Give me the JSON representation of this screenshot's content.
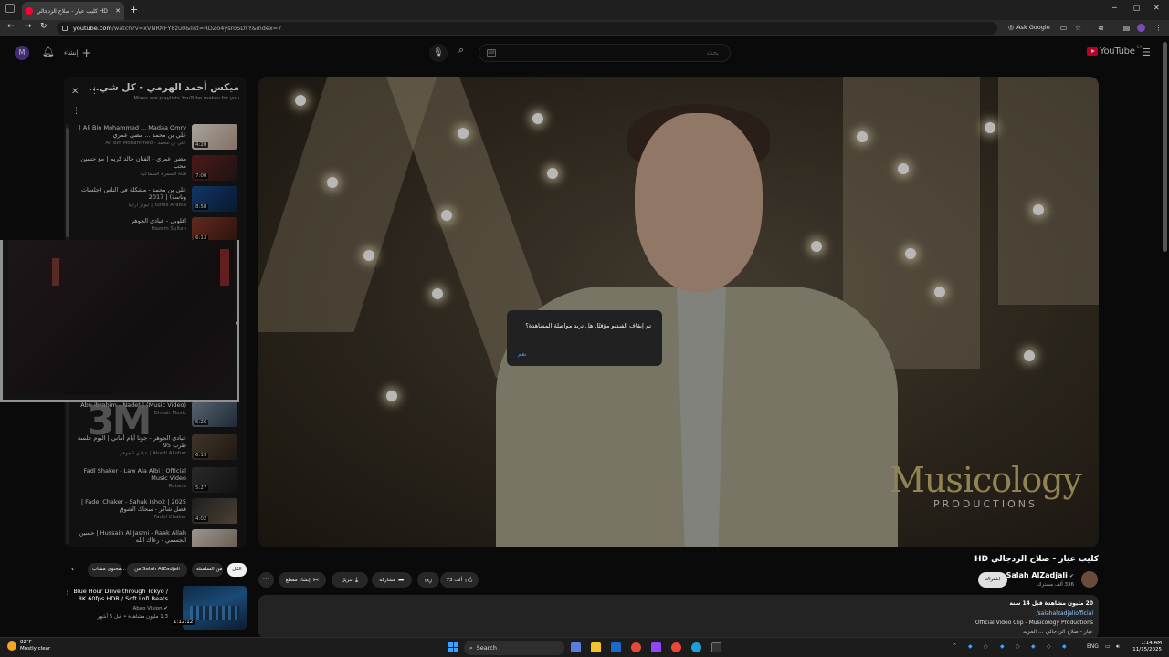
{
  "browser": {
    "tab_title": "كليب عيار - صلاح الزدجالي HD",
    "url_host": "youtube.com",
    "url_path": "/watch?v=xVNRNFY8zu0&list=RDZo4ysroSDYY&index=7",
    "ask_google": "Ask Google"
  },
  "header": {
    "avatar_letter": "M",
    "create_label": "إنشاء",
    "search_placeholder": "بحث",
    "logo_word": "YouTube",
    "logo_region": "SA"
  },
  "playlist": {
    "title": "ميكس أحمد الهرمي - كل شي...",
    "subtitle": "Mixes are playlists YouTube makes for you",
    "items": [
      {
        "title": "Ali Bin Mohammed ... Madaa Omry | علي بن محمد ... مضى عمري",
        "channel": "علي بن محمد - Ali Bin Mohammed",
        "duration": "4:20"
      },
      {
        "title": "مضى عمري - الفنان خالد كريم | مع حسين محب",
        "channel": "قناة السمرة السماعية",
        "duration": "7:00"
      },
      {
        "title": "علي بن محمد - مشكلة في الناس (جلسات وناسة) | 2017",
        "channel": "Tunes Arabia | تيونز أرابيا",
        "duration": "8:58"
      },
      {
        "title": "اقلوبي - عبادي الجوهر",
        "channel": "Hazem Sultan",
        "duration": "6:13"
      },
      {
        "title": "Abu ibrahim - Nadet | (Music Video)",
        "channel": "Dimah Music",
        "duration": "5:26"
      },
      {
        "title": "عبادي الجوهر - جونا أيام أماني | البوم جلسة طرب 95",
        "channel": "Abadi Aljohar | عبادي الجوهر",
        "duration": "6:19"
      },
      {
        "title": "Fadl Shaker - Law Ala Albi | Official Music Video",
        "channel": "Rotana",
        "duration": "5:27"
      },
      {
        "title": "Fadel Chaker - Sahak Isho2 | 2025 | فضل شاكر - سحاك الشوق",
        "channel": "Fadel Chaker",
        "duration": "4:02"
      },
      {
        "title": "Hussain Al Jasmi - Raak Allah | حسين الجسمي - رعاك الله",
        "channel": "",
        "duration": ""
      }
    ]
  },
  "pip": {
    "watermark": "3M"
  },
  "video": {
    "title": "كليب عيار - صلاح الزدجالي HD",
    "pause_message": "تم إيقاف الفيديو مؤقتًا. هل تريد مواصلة المشاهدة؟",
    "pause_confirm": "نعم",
    "brand_word": "Musicology",
    "brand_sub": "PRODUCTIONS"
  },
  "channel": {
    "name": "Salah AlZadjali",
    "subscribers": "336 ألف مشترك",
    "subscribe_label": "اشتراك"
  },
  "actions": {
    "like_count": "73 ألف",
    "share": "مشاركة",
    "download": "تنزيل",
    "clip": "إنشاء مقطع"
  },
  "description": {
    "stats": "20 مليون مشاهدة  قبل 14 سنة",
    "handle": "salahalzadjaliofficial/",
    "line1": "Official Video Clip - Musicology Productions",
    "line2": "عيار - صلاح الزدجالي ... المزيد"
  },
  "chips": {
    "all": "الكل",
    "from_series": "من السلسلة",
    "from_channel": "من Salah AlZadjali",
    "related": "محتوى مشاب..."
  },
  "recommendation": {
    "title": "Blue Hour Drive through Tokyo / 8K 60fps HDR / Soft Lofi Beats",
    "channel": "Abao Vision",
    "meta": "1.3 مليون مشاهدة • قبل 5 أشهر",
    "duration": "1:12:12"
  },
  "taskbar": {
    "temp": "82°F",
    "weather": "Mostly clear",
    "search": "Search",
    "lang": "ENG",
    "time": "1:14 AM",
    "date": "11/15/2025"
  }
}
